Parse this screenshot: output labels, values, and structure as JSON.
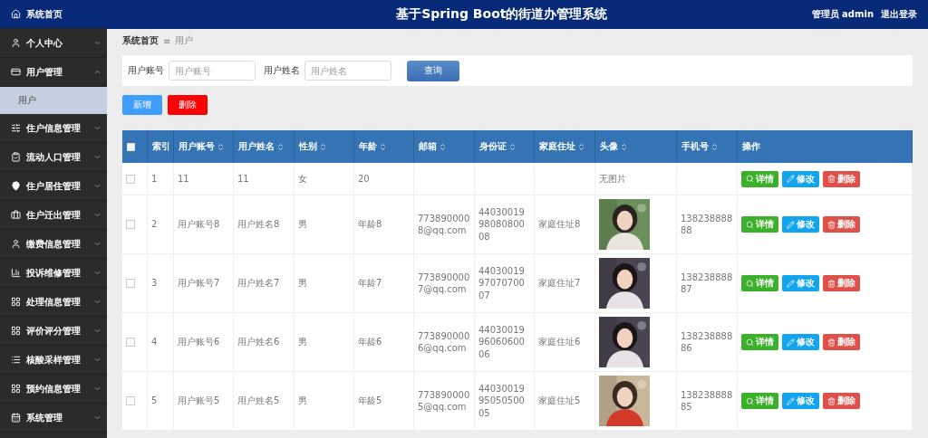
{
  "header": {
    "title": "基于Spring Boot的街道办管理系统",
    "user": "管理员 admin",
    "logout": "退出登录"
  },
  "sidebar": {
    "items": [
      {
        "label": "系统首页",
        "kind": "home",
        "selected": true,
        "expanded": false
      },
      {
        "label": "个人中心",
        "kind": "user",
        "selected": false,
        "expanded": false
      },
      {
        "label": "用户管理",
        "kind": "card",
        "selected": false,
        "expanded": true,
        "children": [
          {
            "label": "用户",
            "selected": true
          }
        ]
      },
      {
        "label": "住户信息管理",
        "kind": "sliders",
        "selected": false,
        "expanded": false
      },
      {
        "label": "流动人口管理",
        "kind": "clipboard",
        "selected": false,
        "expanded": false
      },
      {
        "label": "住户居住管理",
        "kind": "pin",
        "selected": false,
        "expanded": false
      },
      {
        "label": "住户迁出管理",
        "kind": "briefcase",
        "selected": false,
        "expanded": false
      },
      {
        "label": "缴费信息管理",
        "kind": "user",
        "selected": false,
        "expanded": false
      },
      {
        "label": "投诉维修管理",
        "kind": "chart",
        "selected": false,
        "expanded": false
      },
      {
        "label": "处理信息管理",
        "kind": "grid",
        "selected": false,
        "expanded": false
      },
      {
        "label": "评价评分管理",
        "kind": "grid",
        "selected": false,
        "expanded": false
      },
      {
        "label": "核酸采样管理",
        "kind": "list",
        "selected": false,
        "expanded": false
      },
      {
        "label": "预约信息管理",
        "kind": "grid",
        "selected": false,
        "expanded": false
      },
      {
        "label": "系统管理",
        "kind": "calendar",
        "selected": false,
        "expanded": false
      }
    ]
  },
  "breadcrumb": {
    "items": [
      "系统首页",
      "用户"
    ],
    "separator": "≡"
  },
  "search": {
    "fields": [
      {
        "label": "用户账号",
        "placeholder": "用户账号"
      },
      {
        "label": "用户姓名",
        "placeholder": "用户姓名"
      }
    ],
    "button": "查询"
  },
  "actions": [
    {
      "label": "新增",
      "kind": "add"
    },
    {
      "label": "删除",
      "kind": "delete"
    }
  ],
  "table": {
    "all_checked": false,
    "columns": [
      {
        "label": "索引"
      },
      {
        "label": "用户账号",
        "sortable": true
      },
      {
        "label": "用户姓名",
        "sortable": true
      },
      {
        "label": "性别",
        "sortable": true
      },
      {
        "label": "年龄",
        "sortable": true
      },
      {
        "label": "邮箱",
        "sortable": true
      },
      {
        "label": "身份证",
        "sortable": true
      },
      {
        "label": "家庭住址",
        "sortable": true
      },
      {
        "label": "头像",
        "sortable": true
      },
      {
        "label": "手机号",
        "sortable": true
      },
      {
        "label": "操作"
      }
    ],
    "rows": [
      {
        "checked": false,
        "cells": [
          "1",
          "11",
          "11",
          "女",
          "20",
          "",
          "",
          "",
          {
            "kind": "text",
            "text": "无图片"
          },
          ""
        ],
        "buttons": [
          {
            "label": "详情",
            "kind": "detail"
          },
          {
            "label": "修改",
            "kind": "edit"
          },
          {
            "label": "删除",
            "kind": "delete"
          }
        ]
      },
      {
        "checked": false,
        "cells": [
          "2",
          "用户账号8",
          "用户姓名8",
          "男",
          "年龄8",
          "7738900008@qq.com",
          "440300199808080008",
          "家庭住址8",
          {
            "kind": "picture"
          },
          "13823888888"
        ],
        "buttons": [
          {
            "label": "详情",
            "kind": "detail"
          },
          {
            "label": "修改",
            "kind": "edit"
          },
          {
            "label": "删除",
            "kind": "delete"
          }
        ]
      },
      {
        "checked": false,
        "cells": [
          "3",
          "用户账号7",
          "用户姓名7",
          "男",
          "年龄7",
          "7738900007@qq.com",
          "440300199707070007",
          "家庭住址7",
          {
            "kind": "picture"
          },
          "13823888887"
        ],
        "buttons": [
          {
            "label": "详情",
            "kind": "detail"
          },
          {
            "label": "修改",
            "kind": "edit"
          },
          {
            "label": "删除",
            "kind": "delete"
          }
        ]
      },
      {
        "checked": false,
        "cells": [
          "4",
          "用户账号6",
          "用户姓名6",
          "男",
          "年龄6",
          "7738900006@qq.com",
          "440300199606060006",
          "家庭住址6",
          {
            "kind": "picture"
          },
          "13823888886"
        ],
        "buttons": [
          {
            "label": "详情",
            "kind": "detail"
          },
          {
            "label": "修改",
            "kind": "edit"
          },
          {
            "label": "删除",
            "kind": "delete"
          }
        ]
      },
      {
        "checked": false,
        "cells": [
          "5",
          "用户账号5",
          "用户姓名5",
          "男",
          "年龄5",
          "7738900005@qq.com",
          "440300199505050005",
          "家庭住址5",
          {
            "kind": "picture"
          },
          "13823888885"
        ],
        "buttons": [
          {
            "label": "详情",
            "kind": "detail"
          },
          {
            "label": "修改",
            "kind": "edit"
          },
          {
            "label": "删除",
            "kind": "delete"
          }
        ]
      }
    ]
  }
}
